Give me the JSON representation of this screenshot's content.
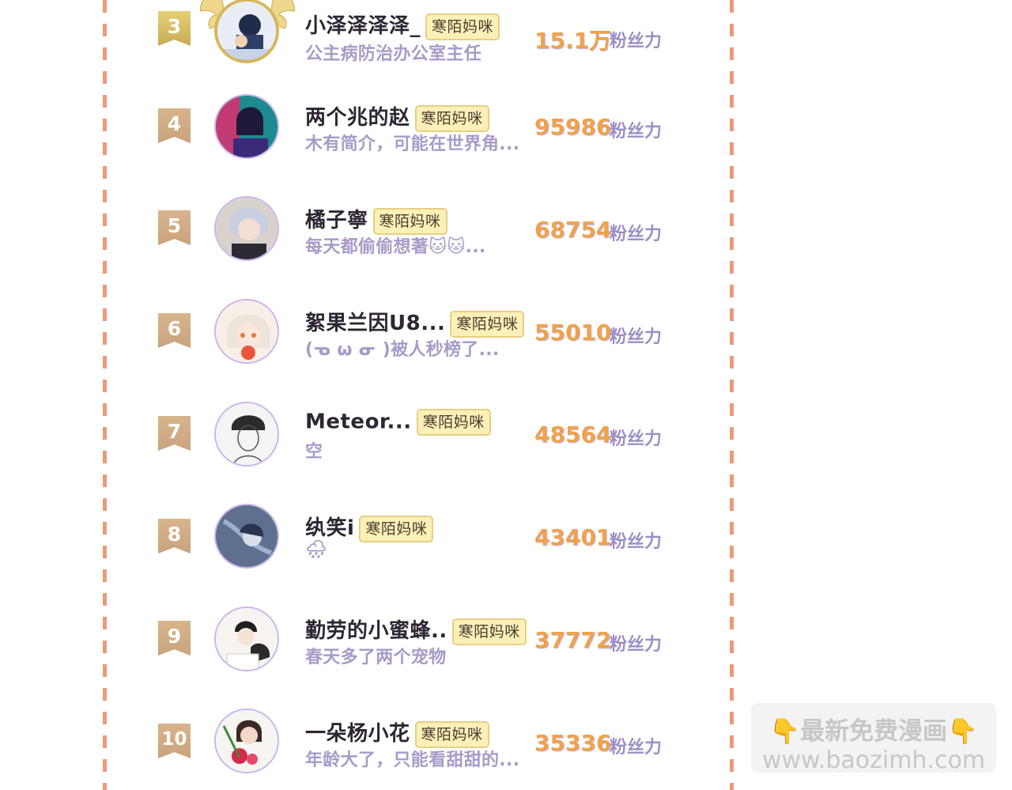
{
  "fans_label": "粉丝力",
  "rows": [
    {
      "rank": "3",
      "name": "小泽泽泽泽_",
      "tag": "寒陌妈咪",
      "desc": "公主病防治办公室主任",
      "score": "15.1万",
      "unit": "粉丝力"
    },
    {
      "rank": "4",
      "name": "两个兆的赵",
      "tag": "寒陌妈咪",
      "desc": "木有简介，可能在世界角...",
      "score": "95986",
      "unit": "粉丝力"
    },
    {
      "rank": "5",
      "name": "橘子寧",
      "tag": "寒陌妈咪",
      "desc": "每天都偷偷想著🐱🐱...",
      "score": "68754",
      "unit": "粉丝力"
    },
    {
      "rank": "6",
      "name": "絮果兰因U8...",
      "tag": "寒陌妈咪",
      "desc": "(ᓀ ω ᓂ )被人秒榜了...",
      "score": "55010",
      "unit": "粉丝力"
    },
    {
      "rank": "7",
      "name": "Meteor...",
      "tag": "寒陌妈咪",
      "desc": "空",
      "score": "48564",
      "unit": "粉丝力"
    },
    {
      "rank": "8",
      "name": "纨笑i",
      "tag": "寒陌妈咪",
      "desc": "🌧",
      "score": "43401",
      "unit": "粉丝力"
    },
    {
      "rank": "9",
      "name": "勤劳的小蜜蜂..",
      "tag": "寒陌妈咪",
      "desc": "春天多了两个宠物",
      "score": "37772",
      "unit": "粉丝力"
    },
    {
      "rank": "10",
      "name": "一朵杨小花",
      "tag": "寒陌妈咪",
      "desc": "年龄大了，只能看甜甜的...",
      "score": "35336",
      "unit": "粉丝力"
    }
  ],
  "promo": {
    "line1": "👇最新免费漫画👇",
    "line2": "www.baozimh.com"
  },
  "colors": {
    "dash": "#ec9a78",
    "score": "#f0a24a",
    "desc": "#a89bc7",
    "tag_bg": "#fdf0b6",
    "badge_gold": "#d6b65d",
    "badge_tan": "#cfa982"
  }
}
